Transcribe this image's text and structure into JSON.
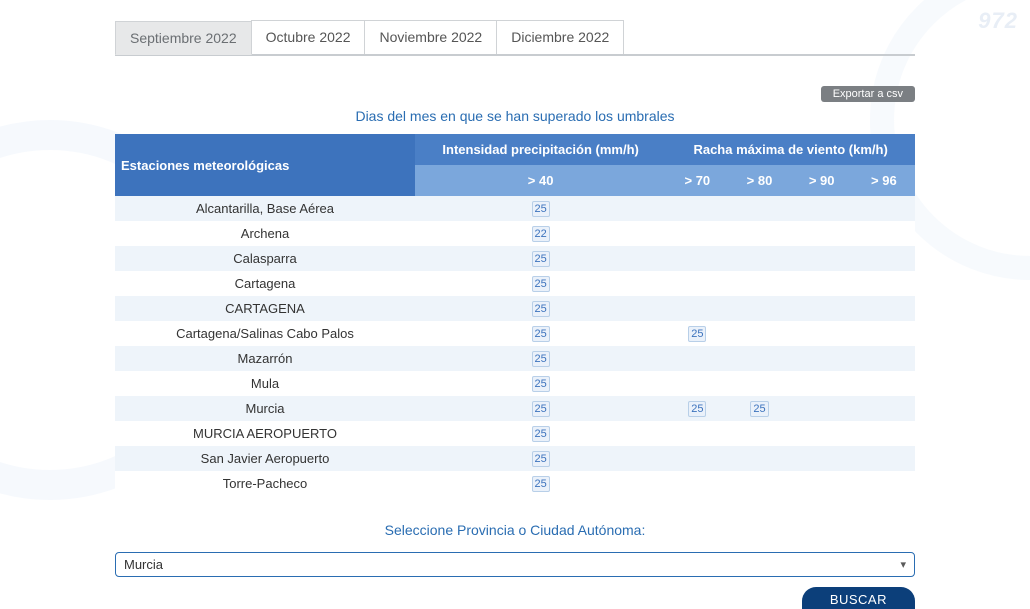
{
  "bg_number": "972",
  "tabs": [
    {
      "label": "Septiembre 2022",
      "active": true
    },
    {
      "label": "Octubre 2022",
      "active": false
    },
    {
      "label": "Noviembre 2022",
      "active": false
    },
    {
      "label": "Diciembre 2022",
      "active": false
    }
  ],
  "export_label": "Exportar a csv",
  "caption": "Dias del mes en que se han superado los umbrales",
  "headers": {
    "stations": "Estaciones meteorológicas",
    "precip_group": "Intensidad precipitación (mm/h)",
    "wind_group": "Racha máxima de viento (km/h)",
    "precip_sub": [
      "> 40"
    ],
    "wind_sub": [
      "> 70",
      "> 80",
      "> 90",
      "> 96"
    ]
  },
  "rows": [
    {
      "station": "Alcantarilla, Base Aérea",
      "p40": "25",
      "w70": "",
      "w80": "",
      "w90": "",
      "w96": ""
    },
    {
      "station": "Archena",
      "p40": "22",
      "w70": "",
      "w80": "",
      "w90": "",
      "w96": ""
    },
    {
      "station": "Calasparra",
      "p40": "25",
      "w70": "",
      "w80": "",
      "w90": "",
      "w96": ""
    },
    {
      "station": "Cartagena",
      "p40": "25",
      "w70": "",
      "w80": "",
      "w90": "",
      "w96": ""
    },
    {
      "station": "CARTAGENA",
      "p40": "25",
      "w70": "",
      "w80": "",
      "w90": "",
      "w96": ""
    },
    {
      "station": "Cartagena/Salinas Cabo Palos",
      "p40": "25",
      "w70": "25",
      "w80": "",
      "w90": "",
      "w96": ""
    },
    {
      "station": "Mazarrón",
      "p40": "25",
      "w70": "",
      "w80": "",
      "w90": "",
      "w96": ""
    },
    {
      "station": "Mula",
      "p40": "25",
      "w70": "",
      "w80": "",
      "w90": "",
      "w96": ""
    },
    {
      "station": "Murcia",
      "p40": "25",
      "w70": "25",
      "w80": "25",
      "w90": "",
      "w96": ""
    },
    {
      "station": "MURCIA AEROPUERTO",
      "p40": "25",
      "w70": "",
      "w80": "",
      "w90": "",
      "w96": ""
    },
    {
      "station": "San Javier Aeropuerto",
      "p40": "25",
      "w70": "",
      "w80": "",
      "w90": "",
      "w96": ""
    },
    {
      "station": "Torre-Pacheco",
      "p40": "25",
      "w70": "",
      "w80": "",
      "w90": "",
      "w96": ""
    }
  ],
  "province": {
    "label": "Seleccione Provincia o Ciudad Autónoma:",
    "selected": "Murcia"
  },
  "search_label": "BUSCAR"
}
